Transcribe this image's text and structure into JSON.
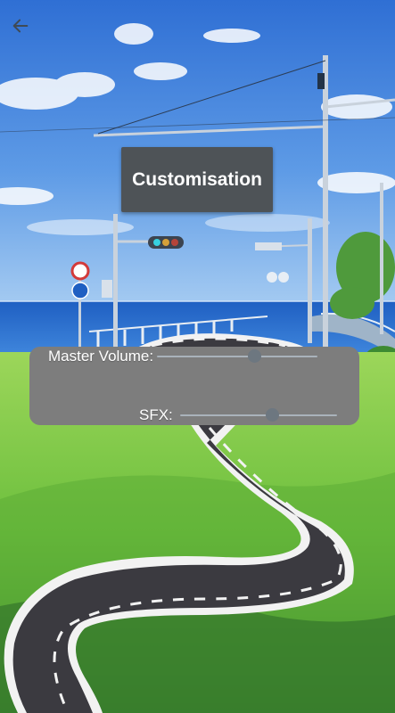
{
  "header": {
    "back_icon": "arrow-left-icon"
  },
  "title_button": {
    "label": "Customisation"
  },
  "settings": {
    "master_volume": {
      "label": "Master Volume:",
      "level": 0.61
    },
    "sfx": {
      "label": "SFX:",
      "level": 0.59
    }
  },
  "colors": {
    "button_bg": "#4e5357",
    "panel_bg": "#7d7d7d",
    "slider_thumb": "#6d7780",
    "slider_track": "#a9b2bb"
  }
}
